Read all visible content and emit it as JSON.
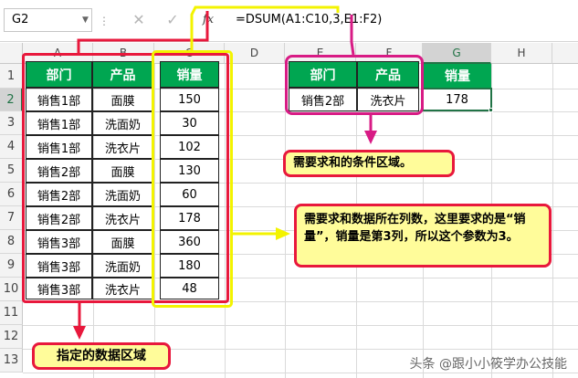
{
  "formula_bar": {
    "name_box": "G2",
    "name_dropdown": "▼",
    "separator": "⋮",
    "cancel": "✕",
    "enter": "✓",
    "fx": "fx",
    "formula": "=DSUM(A1:C10,3,E1:F2)"
  },
  "columns": [
    "A",
    "B",
    "C",
    "D",
    "E",
    "F",
    "G",
    "H"
  ],
  "selected_column": "G",
  "rows": [
    "1",
    "2",
    "3",
    "4",
    "5",
    "6",
    "7",
    "8",
    "9",
    "10",
    "11",
    "12",
    "13"
  ],
  "selected_row": "2",
  "table": {
    "headers": [
      "部门",
      "产品",
      "销量"
    ],
    "data": [
      [
        "销售1部",
        "面膜",
        "150"
      ],
      [
        "销售1部",
        "洗面奶",
        "30"
      ],
      [
        "销售1部",
        "洗衣片",
        "102"
      ],
      [
        "销售2部",
        "面膜",
        "130"
      ],
      [
        "销售2部",
        "洗面奶",
        "60"
      ],
      [
        "销售2部",
        "洗衣片",
        "178"
      ],
      [
        "销售3部",
        "面膜",
        "360"
      ],
      [
        "销售3部",
        "洗面奶",
        "180"
      ],
      [
        "销售3部",
        "洗衣片",
        "48"
      ]
    ]
  },
  "criteria": {
    "headers": [
      "部门",
      "产品"
    ],
    "values": [
      "销售2部",
      "洗衣片"
    ]
  },
  "result": {
    "header": "销量",
    "value": "178"
  },
  "callouts": {
    "criteria": "需要求和的条件区域。",
    "column": "需要求和数据所在列数，这里要求的是“销量”，销量是第3列，所以这个参数为3。",
    "data_range": "指定的数据区域"
  },
  "watermark": "头条 @跟小小筱学办公技能",
  "colors": {
    "header_green": "#00a651",
    "red": "#e8183c",
    "yellow": "#f3f300",
    "pink": "#d81b85",
    "callout_fill": "#fffc9a",
    "excel_green": "#217346"
  }
}
